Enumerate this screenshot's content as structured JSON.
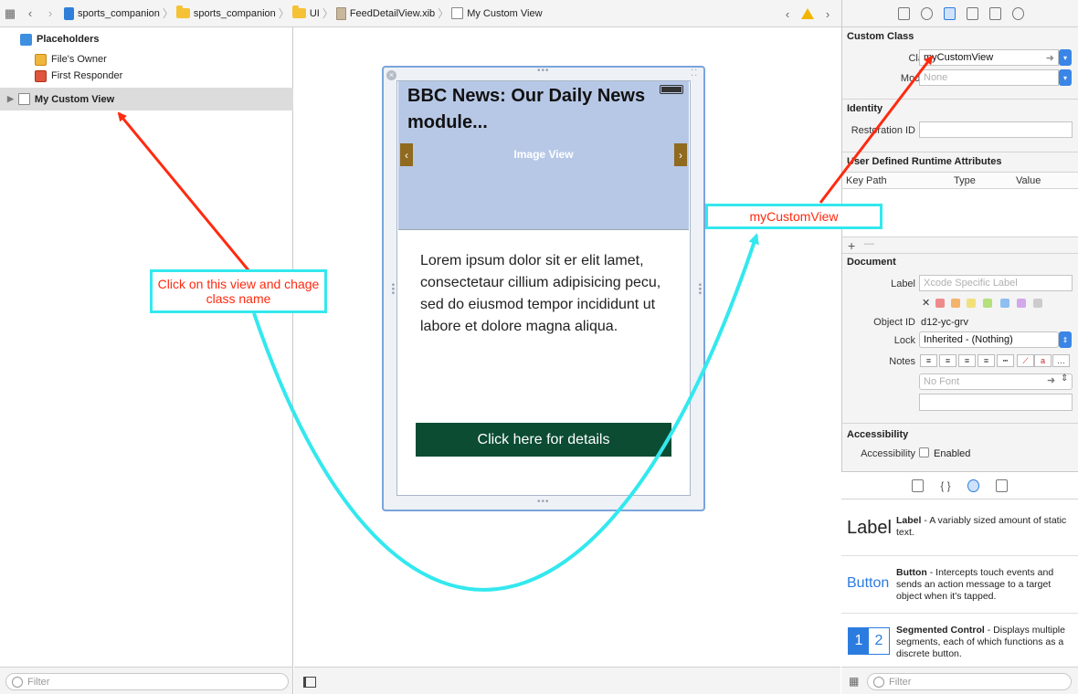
{
  "jumpbar": {
    "crumbs": [
      "sports_companion",
      "sports_companion",
      "UI",
      "FeedDetailView.xib",
      "My Custom View"
    ]
  },
  "outline": {
    "placeholders_label": "Placeholders",
    "files_owner": "File's Owner",
    "first_responder": "First Responder",
    "custom_view": "My Custom View",
    "filter_placeholder": "Filter"
  },
  "canvas": {
    "news_title": "BBC News: Our Daily News module...",
    "image_view_label": "Image View",
    "body_text": "Lorem ipsum dolor sit er elit lamet, consectetaur cillium adipisicing pecu, sed do eiusmod tempor incididunt ut labore et dolore magna aliqua.",
    "details_button": "Click here for details"
  },
  "annotations": {
    "click_view": "Click on this view and chage class name",
    "class_name": "myCustomView"
  },
  "inspector": {
    "custom_class": {
      "title": "Custom Class",
      "class_label": "Class",
      "class_value": "myCustomView",
      "module_label": "Module",
      "module_placeholder": "None"
    },
    "identity": {
      "title": "Identity",
      "restoration_label": "Restoration ID"
    },
    "runtime": {
      "title": "User Defined Runtime Attributes",
      "col_keypath": "Key Path",
      "col_type": "Type",
      "col_value": "Value",
      "add": "+",
      "remove": "—"
    },
    "document": {
      "title": "Document",
      "label_label": "Label",
      "label_placeholder": "Xcode Specific Label",
      "object_id_label": "Object ID",
      "object_id_value": "d12-yc-grv",
      "lock_label": "Lock",
      "lock_value": "Inherited - (Nothing)",
      "notes_label": "Notes",
      "font_placeholder": "No Font",
      "swatches": [
        "#f08a8a",
        "#f4b36a",
        "#f2e07a",
        "#b4e07e",
        "#8ebff0",
        "#d2a8ea",
        "#cccccc"
      ]
    },
    "accessibility": {
      "title": "Accessibility",
      "accessibility_label": "Accessibility",
      "enabled_label": "Enabled"
    }
  },
  "library": {
    "items": [
      {
        "icon_text": "Label",
        "name": "Label",
        "desc": " - A variably sized amount of static text."
      },
      {
        "icon_text": "Button",
        "name": "Button",
        "desc": " - Intercepts touch events and sends an action message to a target object when it's tapped."
      },
      {
        "icon_seg1": "1",
        "icon_seg2": "2",
        "name": "Segmented Control",
        "desc": " - Displays multiple segments, each of which functions as a discrete button."
      }
    ],
    "filter_placeholder": "Filter"
  }
}
